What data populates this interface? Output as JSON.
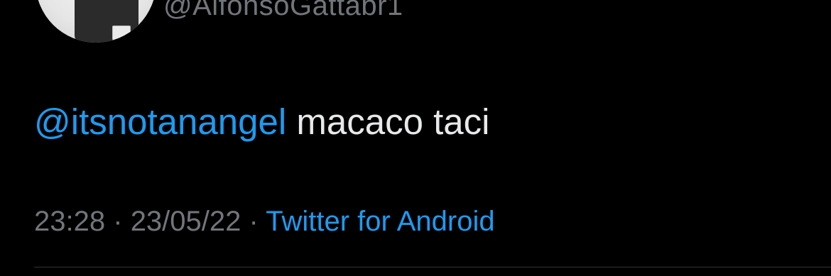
{
  "author": {
    "handle": "@AlfonsoGattabr1",
    "avatar_icon": "profile-photo"
  },
  "tweet": {
    "mention": "@itsnotanangel",
    "text": "macaco taci"
  },
  "meta": {
    "time": "23:28",
    "separator": "·",
    "date": "23/05/22",
    "source": "Twitter for Android"
  },
  "colors": {
    "background": "#000000",
    "link": "#1d9bf0",
    "text": "#e7e9ea",
    "muted": "#71767b"
  }
}
